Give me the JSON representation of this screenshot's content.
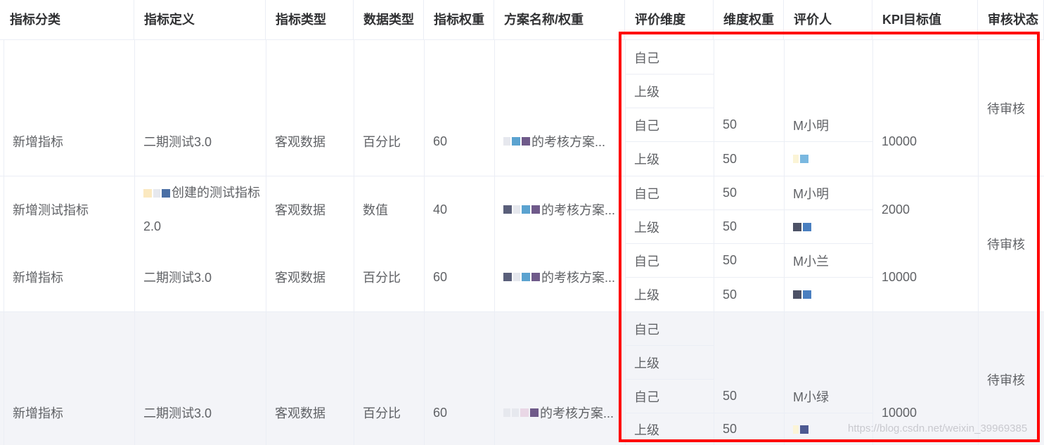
{
  "headers": [
    "指标分类",
    "指标定义",
    "指标类型",
    "数据类型",
    "指标权重",
    "方案名称/权重",
    "评价维度",
    "维度权重",
    "评价人",
    "KPI目标值",
    "审核状态"
  ],
  "groups": [
    {
      "rows": [
        {
          "category": "新增指标",
          "definition": "二期测试3.0",
          "type": "客观数据",
          "dataType": "百分比",
          "weight": "60",
          "plan": "的考核方案...",
          "kpi": "10000"
        }
      ],
      "dimensions": [
        "自己",
        "上级",
        "自己",
        "上级"
      ],
      "dimWeights": [
        "50",
        "50"
      ],
      "evaluators": [
        "M小明",
        ""
      ],
      "status": "待审核"
    },
    {
      "rows": [
        {
          "category": "新增测试指标",
          "definition": "创建的测试指标2.0",
          "type": "客观数据",
          "dataType": "数值",
          "weight": "40",
          "plan": "的考核方案...",
          "kpi": "2000"
        },
        {
          "category": "新增指标",
          "definition": "二期测试3.0",
          "type": "客观数据",
          "dataType": "百分比",
          "weight": "60",
          "plan": "的考核方案...",
          "kpi": "10000"
        }
      ],
      "dimensions": [
        "自己",
        "上级",
        "自己",
        "上级"
      ],
      "dimWeights": [
        "50",
        "50",
        "50",
        "50"
      ],
      "evaluators": [
        "M小明",
        "",
        "M小兰",
        ""
      ],
      "status": "待审核"
    },
    {
      "rows": [
        {
          "category": "新增指标",
          "definition": "二期测试3.0",
          "type": "客观数据",
          "dataType": "百分比",
          "weight": "60",
          "plan": "的考核方案...",
          "kpi": "10000"
        }
      ],
      "dimensions": [
        "自己",
        "上级",
        "自己",
        "上级"
      ],
      "dimWeights": [
        "50",
        "50"
      ],
      "evaluators": [
        "M小绿",
        ""
      ],
      "status": "待审核"
    }
  ],
  "watermark": "https://blog.csdn.net/weixin_39969385",
  "colors": {
    "highlight": "#ff0000",
    "stripe": "#f3f4f8",
    "border": "#ebeef5",
    "header_text": "#303133",
    "text": "#606266"
  }
}
